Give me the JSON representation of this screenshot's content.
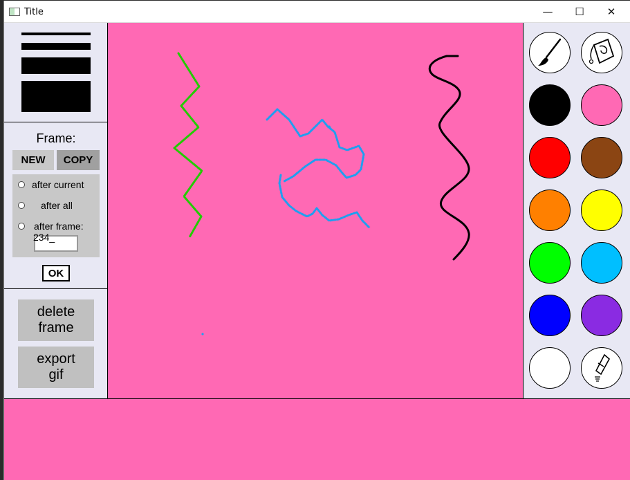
{
  "window": {
    "title": "Title",
    "minimize_glyph": "—",
    "maximize_glyph": "☐",
    "close_glyph": "✕"
  },
  "frame_panel": {
    "label": "Frame:",
    "new_label": "NEW",
    "copy_label": "COPY",
    "options": [
      "after current",
      "after all",
      "after frame:"
    ],
    "frame_number_value": "234_",
    "ok_label": "OK"
  },
  "actions": {
    "delete_line1": "delete",
    "delete_line2": "frame",
    "export_line1": "export",
    "export_line2": "gif"
  },
  "colors": {
    "canvas_background": "#ff69b4",
    "panel_background": "#e8e8f4",
    "palette": [
      "#000000",
      "#ff69b4",
      "#ff0000",
      "#8b4513",
      "#ff8000",
      "#ffff00",
      "#00ff00",
      "#00bfff",
      "#0000ff",
      "#8a2be2",
      "#ffffff"
    ],
    "stroke_green": "#22cc00",
    "stroke_blue": "#1e9ff0",
    "stroke_black": "#000000"
  },
  "tools": {
    "brush_icon": "paintbrush-icon",
    "fill_icon": "paint-bucket-icon",
    "eraser_icon": "eraser-icon"
  }
}
